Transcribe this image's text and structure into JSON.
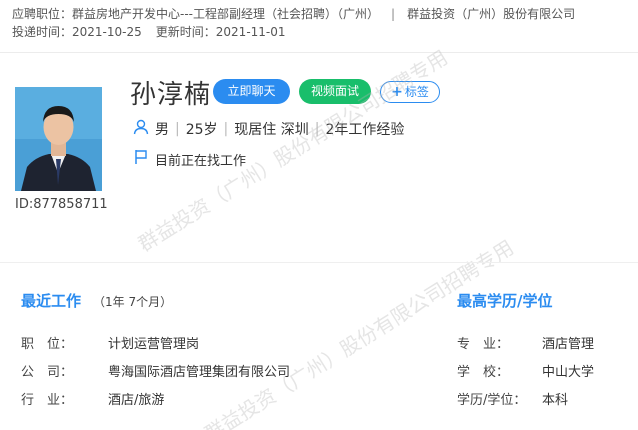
{
  "header": {
    "position_label": "应聘职位：",
    "position_value": "群益房地产开发中心---工程部副经理（社会招聘）（广州）",
    "separator": "|",
    "company": "群益投资（广州）股份有限公司",
    "submit_label": "投递时间：",
    "submit_date": "2021-10-25",
    "update_label": "更新时间：",
    "update_date": "2021-11-01"
  },
  "profile": {
    "name": "孙淳楠",
    "id_text": "ID:877858711",
    "gender": "男",
    "age": "25岁",
    "location": "现居住 深圳",
    "experience": "2年工作经验",
    "status": "目前正在找工作",
    "separator": "|"
  },
  "actions": {
    "chat_label": "立即聊天",
    "video_label": "视频面试",
    "tag_label": "标签"
  },
  "watermark": {
    "text1": "群益投资（广州）股份有限公司招聘专用",
    "text2": "群益投资（广州）股份有限公司招聘专用"
  },
  "recent_work": {
    "title": "最近工作",
    "duration": "（1年 7个月）",
    "rows": [
      {
        "label": "职　位：",
        "value": "计划运营管理岗"
      },
      {
        "label": "公　司：",
        "value": "粤海国际酒店管理集团有限公司"
      },
      {
        "label": "行　业：",
        "value": "酒店/旅游"
      }
    ]
  },
  "education": {
    "title": "最高学历/学位",
    "rows": [
      {
        "label": "专　业：",
        "value": "酒店管理"
      },
      {
        "label": "学　校：",
        "value": "中山大学"
      },
      {
        "label": "学历/学位：",
        "value": "本科"
      }
    ]
  },
  "colors": {
    "primary": "#2b8cf0",
    "success": "#19be6b"
  }
}
